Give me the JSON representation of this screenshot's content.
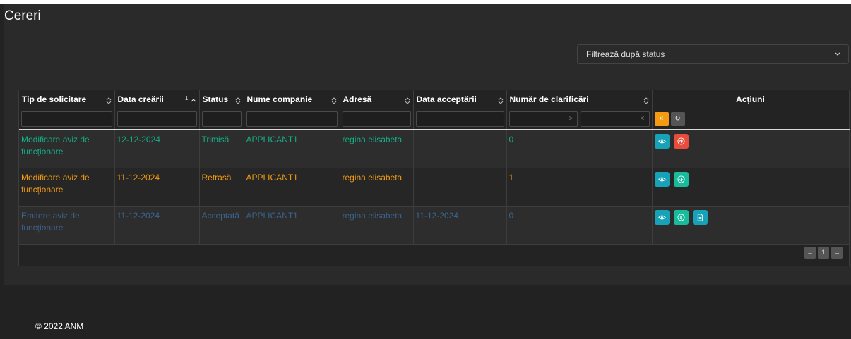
{
  "page": {
    "title": "Cereri"
  },
  "filter": {
    "placeholder": "Filtrează după status"
  },
  "table": {
    "columns": [
      {
        "label": "Tip de solicitare",
        "sortable": true
      },
      {
        "label": "Data creării",
        "sortable": true,
        "sort_order": "1",
        "sort_direction": "asc"
      },
      {
        "label": "Status",
        "sortable": true
      },
      {
        "label": "Nume companie",
        "sortable": true
      },
      {
        "label": "Adresă",
        "sortable": true
      },
      {
        "label": "Data acceptării",
        "sortable": true
      },
      {
        "label": "Număr de clarificări",
        "sortable": true
      },
      {
        "label": "Acțiuni",
        "sortable": false
      }
    ],
    "range_filter": {
      "min_glyph": ">",
      "max_glyph": "<"
    },
    "filter_buttons": {
      "clear_glyph": "×",
      "reset_glyph": "↻"
    },
    "rows": [
      {
        "type": "Modificare aviz de funcționare",
        "created": "12-12-2024",
        "status": "Trimisă",
        "company": "APPLICANT1",
        "address": "regina elisabeta",
        "accepted": "",
        "clarifications": "0",
        "text_color": "#14b085",
        "actions": [
          {
            "name": "view",
            "icon": "eye-icon",
            "color": "#17a2b8"
          },
          {
            "name": "withdraw",
            "icon": "arrow-up-circle-icon",
            "color": "#e74c3c"
          }
        ]
      },
      {
        "type": "Modificare aviz de funcționare",
        "created": "11-12-2024",
        "status": "Retrasă",
        "company": "APPLICANT1",
        "address": "regina elisabeta",
        "accepted": "",
        "clarifications": "1",
        "text_color": "#f39c12",
        "actions": [
          {
            "name": "view",
            "icon": "eye-icon",
            "color": "#17a2b8"
          },
          {
            "name": "download",
            "icon": "arrow-down-circle-icon",
            "color": "#18bc9c"
          }
        ]
      },
      {
        "type": "Emitere aviz de funcționare",
        "created": "11-12-2024",
        "status": "Acceptată",
        "company": "APPLICANT1",
        "address": "regina elisabeta",
        "accepted": "11-12-2024",
        "clarifications": "0",
        "text_color": "#3b648f",
        "actions": [
          {
            "name": "view",
            "icon": "eye-icon",
            "color": "#17a2b8"
          },
          {
            "name": "payment",
            "icon": "dollar-circle-icon",
            "color": "#18bc9c"
          },
          {
            "name": "document",
            "icon": "document-icon",
            "color": "#17a2b8"
          }
        ]
      }
    ]
  },
  "pagination": {
    "prev": "←",
    "page": "1",
    "next": "→"
  },
  "footer": {
    "text": "© 2022 ANM"
  },
  "colors": {
    "background": "#222222",
    "panel": "#2a2a2a",
    "warning": "#f39c12",
    "info": "#17a2b8",
    "success": "#18bc9c",
    "danger": "#e74c3c"
  }
}
